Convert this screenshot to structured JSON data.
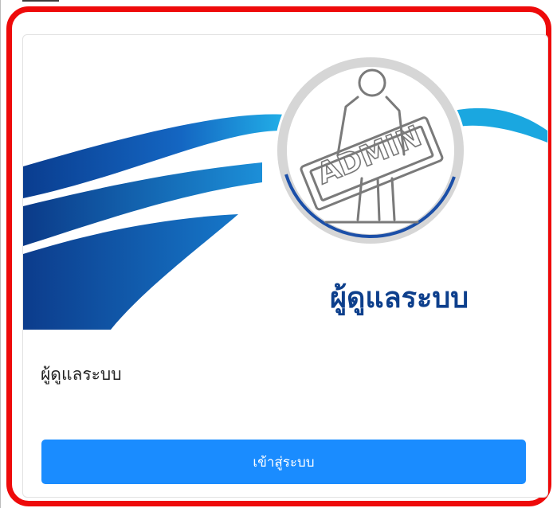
{
  "banner": {
    "sign_text": "ADMIN",
    "caption": "ผู้ดูแลระบบ"
  },
  "card": {
    "title": "ผู้ดูแลระบบ",
    "button_label": "เข้าสู่ระบบ"
  },
  "colors": {
    "frame_border": "#ee0a0a",
    "button_bg": "#1a8cff",
    "wave_dark": "#0b3f8f",
    "wave_light": "#1aa7e0",
    "caption_color": "#0d3f8c"
  }
}
